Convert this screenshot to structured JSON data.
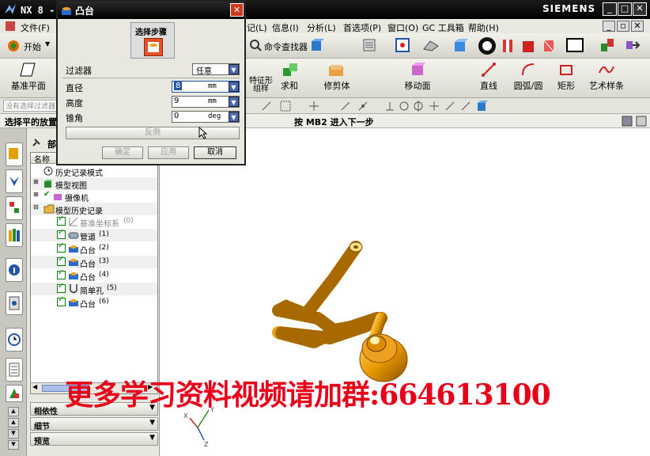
{
  "titlebar": {
    "title": "NX 8 - 建",
    "brand": "SIEMENS",
    "min": "_",
    "max": "□",
    "close": "✕"
  },
  "menubar": {
    "items": [
      "文件(F)",
      "记(L)",
      "信息(I)",
      "分析(L)",
      "首选项(P)",
      "窗口(O)",
      "GC 工具箱",
      "帮助(H)"
    ]
  },
  "toolbar1": {
    "start_label": "开始",
    "command_finder": "命令查找器"
  },
  "ribbon": {
    "datum_plane": "基准平面",
    "feature_group": "特征形\n组样",
    "unite": "求和",
    "trim_body": "修剪体",
    "move_face": "移动面",
    "line": "直线",
    "arc": "圆弧/圆",
    "rectangle": "矩形",
    "spline": "艺术样条"
  },
  "toolbar3": {
    "filter_hint": "没有选择过滤器"
  },
  "status": {
    "left": "选择平的放置面",
    "right": "按 MB2 进入下一步"
  },
  "navigator": {
    "title": "部",
    "column_name": "名称",
    "items": [
      {
        "label": "历史记录模式",
        "icon": "clock-icon"
      },
      {
        "label": "模型视图",
        "icon": "model-view-icon"
      },
      {
        "label": "摄像机",
        "icon": "camera-icon"
      },
      {
        "label": "模型历史记录",
        "icon": "folder-icon"
      },
      {
        "label": "基准坐标系",
        "index": "(0)",
        "icon": "datum-csys-icon"
      },
      {
        "label": "管道",
        "index": "(1)",
        "icon": "tube-icon"
      },
      {
        "label": "凸台",
        "index": "(2)",
        "icon": "boss-icon"
      },
      {
        "label": "凸台",
        "index": "(3)",
        "icon": "boss-icon"
      },
      {
        "label": "凸台",
        "index": "(4)",
        "icon": "boss-icon"
      },
      {
        "label": "简单孔",
        "index": "(5)",
        "icon": "hole-icon"
      },
      {
        "label": "凸台",
        "index": "(6)",
        "icon": "boss-icon"
      }
    ],
    "panels": [
      "相依性",
      "细节",
      "预览"
    ]
  },
  "dialog": {
    "title": "凸台",
    "step_label": "选择步骤",
    "filter_label": "过滤器",
    "filter_value": "任意",
    "diameter_label": "直径",
    "diameter_value": "8",
    "diameter_unit": "mm",
    "height_label": "高度",
    "height_value": "9",
    "height_unit": "mm",
    "taper_label": "锥角",
    "taper_value": "0",
    "taper_unit": "deg",
    "reverse_label": "反侧",
    "ok_label": "确定",
    "apply_label": "应用",
    "cancel_label": "取消"
  },
  "watermark": "更多学习资料视频请加群:664613100",
  "colors": {
    "model": "#e89a00",
    "watermark": "#e8001a",
    "dialog_title": "#000000",
    "spin": "#4a6ab0"
  }
}
